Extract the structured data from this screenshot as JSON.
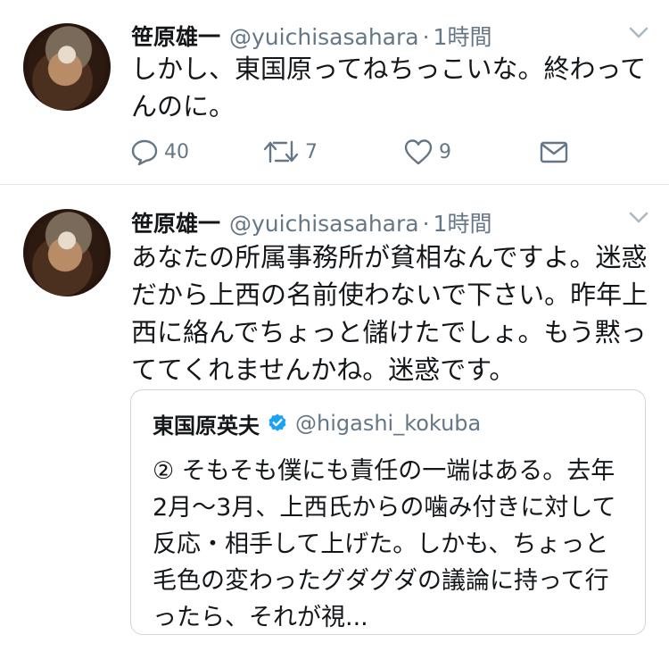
{
  "colors": {
    "text": "#14171a",
    "muted": "#657786",
    "verified": "#1da1f2",
    "border": "#e1e8ed"
  },
  "tweets": [
    {
      "name": "笹原雄一",
      "handle": "@yuichisasahara",
      "separator": "·",
      "time": "1時間",
      "text": "しかし、東国原ってねちっこいな。終わってんのに。",
      "actions": {
        "reply_count": "40",
        "retweet_count": "7",
        "like_count": "9"
      }
    },
    {
      "name": "笹原雄一",
      "handle": "@yuichisasahara",
      "separator": "·",
      "time": "1時間",
      "text": "あなたの所属事務所が貧相なんですよ。迷惑だから上西の名前使わないで下さい。昨年上西に絡んでちょっと儲けたでしょ。もう黙っててくれませんかね。迷惑です。",
      "quote": {
        "name": "東国原英夫",
        "handle": "@higashi_kokuba",
        "text": "② そもそも僕にも責任の一端はある。去年2月〜3月、上西氏からの噛み付きに対して反応・相手して上げた。しかも、ちょっと毛色の変わったグダグダの議論に持って行ったら、それが視..."
      }
    }
  ],
  "icons": [
    "avatar-image",
    "chevron-down-icon",
    "reply-icon",
    "retweet-icon",
    "heart-icon",
    "envelope-icon",
    "verified-badge-icon"
  ]
}
